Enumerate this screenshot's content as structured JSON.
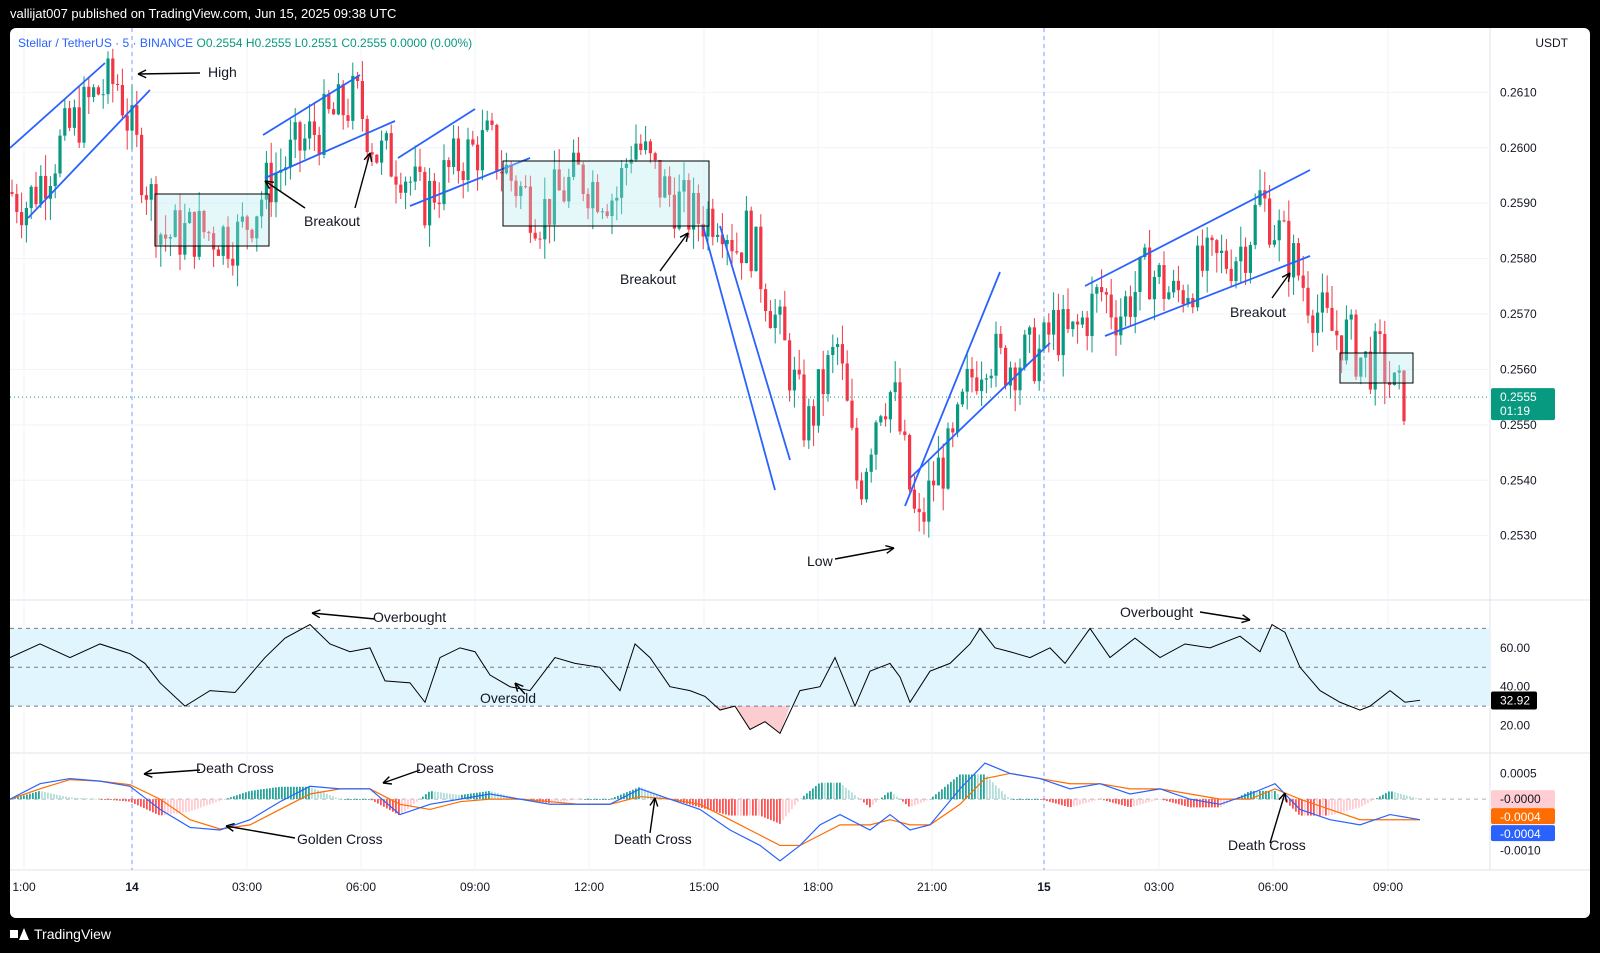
{
  "publisher": "vallijat007 published on TradingView.com, Jun 15, 2025 09:38 UTC",
  "brand": "TradingView",
  "legend": {
    "symbol": "Stellar / TetherUS · 5 · BINANCE",
    "open": "O0.2554",
    "high": "H0.2555",
    "low": "L0.2551",
    "close": "C0.2555",
    "change": "0.0000 (0.00%)"
  },
  "currency": "USDT",
  "colors": {
    "up": "#089981",
    "down": "#f23645",
    "trendline": "#2962ff",
    "macd": "#2962ff",
    "signal": "#ff6d00",
    "rsi": "#000000",
    "rsi_band": "#e1f5fe"
  },
  "last_price_label": {
    "price": "0.2555",
    "countdown": "01:19"
  },
  "rsi_value_label": "32.92",
  "macd_labels": {
    "hist": "-0.0000",
    "signal": "-0.0004",
    "macd": "-0.0004"
  },
  "chart_data": {
    "type": "candlestick",
    "timeframe": "5",
    "exchange": "BINANCE",
    "price_axis": {
      "ticks": [
        "0.2610",
        "0.2600",
        "0.2590",
        "0.2580",
        "0.2570",
        "0.2560",
        "0.2550",
        "0.2540",
        "0.2530"
      ],
      "range": [
        0.2522,
        0.2618
      ]
    },
    "time_axis": {
      "ticks": [
        "1:00",
        "14",
        "03:00",
        "06:00",
        "09:00",
        "12:00",
        "15:00",
        "18:00",
        "21:00",
        "15",
        "03:00",
        "06:00",
        "09:00"
      ]
    },
    "price_path": [
      {
        "t": "00:00",
        "price": 0.2592
      },
      {
        "t": "00:25",
        "price": 0.259
      },
      {
        "t": "01:20",
        "price": 0.2602
      },
      {
        "t": "02:05",
        "price": 0.261
      },
      {
        "t": "02:35",
        "price": 0.2612
      },
      {
        "t": "02:55",
        "price": 0.2603
      },
      {
        "t": "03:40",
        "price": 0.2584
      },
      {
        "t": "04:30",
        "price": 0.2585
      },
      {
        "t": "05:30",
        "price": 0.2584
      },
      {
        "t": "06:20",
        "price": 0.2595
      },
      {
        "t": "07:20",
        "price": 0.2603
      },
      {
        "t": "08:20",
        "price": 0.2609
      },
      {
        "t": "08:50",
        "price": 0.2599
      },
      {
        "t": "09:25",
        "price": 0.2597
      },
      {
        "t": "09:55",
        "price": 0.259
      },
      {
        "t": "10:50",
        "price": 0.2598
      },
      {
        "t": "11:30",
        "price": 0.2601
      },
      {
        "t": "12:00",
        "price": 0.2595
      },
      {
        "t": "12:45",
        "price": 0.2588
      },
      {
        "t": "13:40",
        "price": 0.2595
      },
      {
        "t": "14:35",
        "price": 0.2591
      },
      {
        "t": "15:00",
        "price": 0.2602
      },
      {
        "t": "15:40",
        "price": 0.2593
      },
      {
        "t": "16:30",
        "price": 0.2587
      },
      {
        "t": "17:05",
        "price": 0.2589
      },
      {
        "t": "17:30",
        "price": 0.2582
      },
      {
        "t": "17:45",
        "price": 0.2585
      },
      {
        "t": "18:35",
        "price": 0.2565
      },
      {
        "t": "19:10",
        "price": 0.2549
      },
      {
        "t": "19:35",
        "price": 0.2558
      },
      {
        "t": "19:55",
        "price": 0.2564
      },
      {
        "t": "20:25",
        "price": 0.2538
      },
      {
        "t": "20:55",
        "price": 0.2555
      },
      {
        "t": "21:15",
        "price": 0.2556
      },
      {
        "t": "21:50",
        "price": 0.253
      },
      {
        "t": "22:15",
        "price": 0.2541
      },
      {
        "t": "22:40",
        "price": 0.2545
      },
      {
        "t": "23:05",
        "price": 0.2558
      },
      {
        "t": "23:30",
        "price": 0.2564
      },
      {
        "t": "23:50",
        "price": 0.2561
      },
      {
        "t": "00:50",
        "price": 0.2563
      },
      {
        "t": "01:05",
        "price": 0.2568
      },
      {
        "t": "01:30",
        "price": 0.2565
      },
      {
        "t": "02:15",
        "price": 0.2574
      },
      {
        "t": "02:40",
        "price": 0.257
      },
      {
        "t": "03:25",
        "price": 0.2578
      },
      {
        "t": "04:00",
        "price": 0.2573
      },
      {
        "t": "04:40",
        "price": 0.2578
      },
      {
        "t": "05:20",
        "price": 0.258
      },
      {
        "t": "05:45",
        "price": 0.2583
      },
      {
        "t": "06:05",
        "price": 0.2591
      },
      {
        "t": "06:25",
        "price": 0.2586
      },
      {
        "t": "06:50",
        "price": 0.258
      },
      {
        "t": "07:20",
        "price": 0.2572
      },
      {
        "t": "07:45",
        "price": 0.2567
      },
      {
        "t": "08:10",
        "price": 0.2566
      },
      {
        "t": "08:35",
        "price": 0.2561
      },
      {
        "t": "09:00",
        "price": 0.2562
      },
      {
        "t": "09:20",
        "price": 0.2555
      },
      {
        "t": "09:38",
        "price": 0.2555
      }
    ],
    "rsi": {
      "ticks": [
        "60.00",
        "40.00",
        "20.00"
      ],
      "levels": [
        70,
        50,
        30
      ],
      "current": 32.92,
      "path": [
        [
          0,
          55
        ],
        [
          30,
          62
        ],
        [
          60,
          55
        ],
        [
          90,
          62
        ],
        [
          120,
          57
        ],
        [
          135,
          52
        ],
        [
          150,
          42
        ],
        [
          175,
          30
        ],
        [
          200,
          38
        ],
        [
          225,
          37
        ],
        [
          255,
          55
        ],
        [
          275,
          65
        ],
        [
          300,
          72
        ],
        [
          320,
          62
        ],
        [
          340,
          58
        ],
        [
          360,
          60
        ],
        [
          375,
          43
        ],
        [
          400,
          42
        ],
        [
          415,
          32
        ],
        [
          430,
          55
        ],
        [
          450,
          60
        ],
        [
          465,
          58
        ],
        [
          480,
          46
        ],
        [
          500,
          40
        ],
        [
          520,
          38
        ],
        [
          545,
          55
        ],
        [
          565,
          52
        ],
        [
          590,
          50
        ],
        [
          610,
          38
        ],
        [
          625,
          62
        ],
        [
          640,
          55
        ],
        [
          660,
          40
        ],
        [
          680,
          38
        ],
        [
          695,
          35
        ],
        [
          710,
          28
        ],
        [
          725,
          30
        ],
        [
          740,
          18
        ],
        [
          755,
          22
        ],
        [
          770,
          16
        ],
        [
          790,
          38
        ],
        [
          810,
          40
        ],
        [
          825,
          55
        ],
        [
          845,
          30
        ],
        [
          860,
          48
        ],
        [
          880,
          52
        ],
        [
          890,
          45
        ],
        [
          900,
          32
        ],
        [
          920,
          48
        ],
        [
          940,
          52
        ],
        [
          960,
          62
        ],
        [
          970,
          70
        ],
        [
          985,
          60
        ],
        [
          1000,
          58
        ],
        [
          1020,
          55
        ],
        [
          1040,
          60
        ],
        [
          1055,
          52
        ],
        [
          1080,
          70
        ],
        [
          1100,
          55
        ],
        [
          1125,
          65
        ],
        [
          1150,
          55
        ],
        [
          1175,
          62
        ],
        [
          1200,
          60
        ],
        [
          1230,
          66
        ],
        [
          1250,
          58
        ],
        [
          1262,
          72
        ],
        [
          1275,
          68
        ],
        [
          1290,
          50
        ],
        [
          1310,
          38
        ],
        [
          1330,
          32
        ],
        [
          1350,
          28
        ],
        [
          1360,
          30
        ],
        [
          1380,
          38
        ],
        [
          1395,
          32
        ],
        [
          1410,
          33
        ]
      ]
    },
    "macd": {
      "ticks": [
        "0.0005",
        "-0.0000",
        "-0.0004",
        "-0.0004",
        "-0.0010"
      ],
      "macd_path": [
        [
          0,
          0.0
        ],
        [
          30,
          0.0003
        ],
        [
          60,
          0.0004
        ],
        [
          90,
          0.00035
        ],
        [
          120,
          0.00025
        ],
        [
          150,
          -0.0002
        ],
        [
          180,
          -0.00055
        ],
        [
          210,
          -0.0006
        ],
        [
          240,
          -0.0004
        ],
        [
          270,
          -5e-05
        ],
        [
          300,
          0.00025
        ],
        [
          330,
          0.0002
        ],
        [
          360,
          0.0002
        ],
        [
          390,
          -0.0003
        ],
        [
          420,
          -0.0001
        ],
        [
          450,
          0.0
        ],
        [
          480,
          0.0001
        ],
        [
          510,
          0.0
        ],
        [
          540,
          -0.0001
        ],
        [
          570,
          -0.0001
        ],
        [
          600,
          -0.0001
        ],
        [
          630,
          0.0002
        ],
        [
          660,
          0.0
        ],
        [
          690,
          -0.0002
        ],
        [
          720,
          -0.0006
        ],
        [
          750,
          -0.0009
        ],
        [
          770,
          -0.0012
        ],
        [
          790,
          -0.0009
        ],
        [
          810,
          -0.0005
        ],
        [
          830,
          -0.0003
        ],
        [
          860,
          -0.0006
        ],
        [
          880,
          -0.0003
        ],
        [
          900,
          -0.0006
        ],
        [
          920,
          -0.0005
        ],
        [
          950,
          0.0002
        ],
        [
          975,
          0.0007
        ],
        [
          1000,
          0.0005
        ],
        [
          1030,
          0.0004
        ],
        [
          1060,
          0.0002
        ],
        [
          1090,
          0.0003
        ],
        [
          1120,
          0.0001
        ],
        [
          1150,
          0.0002
        ],
        [
          1180,
          0.0
        ],
        [
          1210,
          -0.0001
        ],
        [
          1240,
          0.0001
        ],
        [
          1265,
          0.0003
        ],
        [
          1290,
          -0.0002
        ],
        [
          1320,
          -0.0004
        ],
        [
          1350,
          -0.0005
        ],
        [
          1380,
          -0.0003
        ],
        [
          1410,
          -0.0004
        ]
      ],
      "signal_path": [
        [
          0,
          0.0
        ],
        [
          30,
          0.0002
        ],
        [
          60,
          0.00038
        ],
        [
          90,
          0.00035
        ],
        [
          120,
          0.00028
        ],
        [
          150,
          0.0
        ],
        [
          180,
          -0.0004
        ],
        [
          210,
          -0.00058
        ],
        [
          240,
          -0.0005
        ],
        [
          270,
          -0.0002
        ],
        [
          300,
          0.0001
        ],
        [
          330,
          0.0002
        ],
        [
          360,
          0.0002
        ],
        [
          390,
          -0.0001
        ],
        [
          420,
          -0.0002
        ],
        [
          450,
          -5e-05
        ],
        [
          480,
          0.0
        ],
        [
          510,
          0.0
        ],
        [
          540,
          -5e-05
        ],
        [
          570,
          -0.0001
        ],
        [
          600,
          -0.0001
        ],
        [
          630,
          5e-05
        ],
        [
          660,
          0.0
        ],
        [
          690,
          -0.0001
        ],
        [
          720,
          -0.0004
        ],
        [
          750,
          -0.0007
        ],
        [
          770,
          -0.0009
        ],
        [
          790,
          -0.0009
        ],
        [
          810,
          -0.0007
        ],
        [
          830,
          -0.0005
        ],
        [
          860,
          -0.0005
        ],
        [
          880,
          -0.0004
        ],
        [
          900,
          -0.0005
        ],
        [
          920,
          -0.0005
        ],
        [
          950,
          -0.0001
        ],
        [
          975,
          0.0004
        ],
        [
          1000,
          0.0005
        ],
        [
          1030,
          0.0004
        ],
        [
          1060,
          0.0003
        ],
        [
          1090,
          0.0003
        ],
        [
          1120,
          0.0002
        ],
        [
          1150,
          0.0002
        ],
        [
          1180,
          0.0001
        ],
        [
          1210,
          0.0
        ],
        [
          1240,
          0.0
        ],
        [
          1265,
          0.0002
        ],
        [
          1290,
          0.0
        ],
        [
          1320,
          -0.0002
        ],
        [
          1350,
          -0.0004
        ],
        [
          1380,
          -0.0004
        ],
        [
          1410,
          -0.0004
        ]
      ]
    },
    "annotations": [
      {
        "text": "High"
      },
      {
        "text": "Breakout"
      },
      {
        "text": "Breakout"
      },
      {
        "text": "Breakout"
      },
      {
        "text": "Low"
      },
      {
        "text": "Overbought"
      },
      {
        "text": "Oversold"
      },
      {
        "text": "Overbought"
      },
      {
        "text": "Death Cross"
      },
      {
        "text": "Golden Cross"
      },
      {
        "text": "Death Cross"
      },
      {
        "text": "Death Cross"
      },
      {
        "text": "Death Cross"
      }
    ]
  }
}
